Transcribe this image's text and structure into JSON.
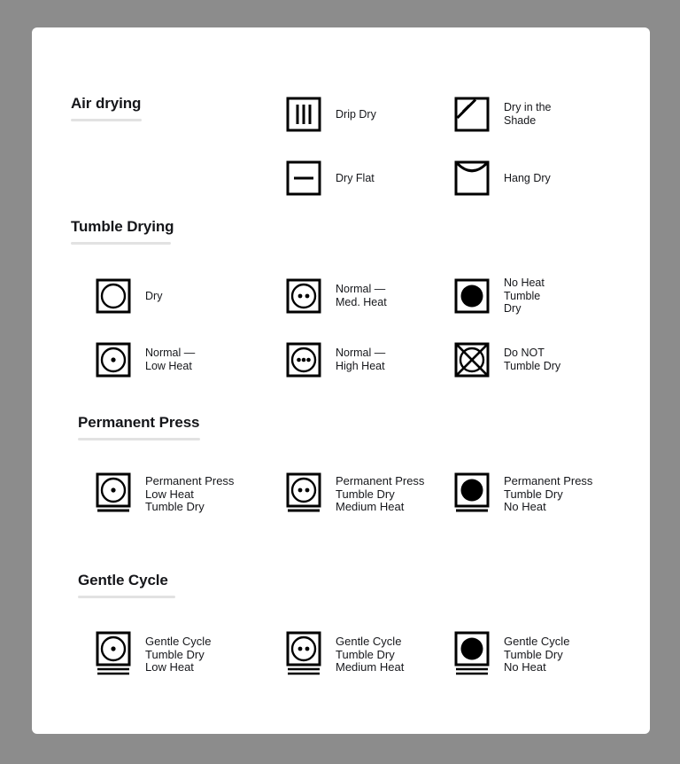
{
  "page": {
    "background_color": "#8c8c8c",
    "card_color": "#ffffff",
    "ink_color": "#000000",
    "rule_color": "#e2e2e2"
  },
  "sections": [
    {
      "id": "air-drying",
      "heading": "Air drying",
      "items": [
        {
          "id": "drip-dry",
          "icon": "square-three-vertical-lines-icon",
          "label": "Drip Dry"
        },
        {
          "id": "dry-in-shade",
          "icon": "square-diagonal-lines-corner-icon",
          "label": "Dry in the\nShade"
        },
        {
          "id": "dry-flat",
          "icon": "square-horizontal-line-icon",
          "label": "Dry Flat"
        },
        {
          "id": "hang-dry",
          "icon": "square-arc-icon",
          "label": "Hang Dry"
        }
      ]
    },
    {
      "id": "tumble-drying",
      "heading": "Tumble Drying",
      "items": [
        {
          "id": "tumble-dry",
          "icon": "square-circle-icon",
          "label": "Dry"
        },
        {
          "id": "normal-med-heat",
          "icon": "square-circle-two-dots-icon",
          "label": "Normal —\nMed. Heat"
        },
        {
          "id": "no-heat-tumble-dry",
          "icon": "square-filled-circle-icon",
          "label": "No Heat\nTumble\nDry"
        },
        {
          "id": "normal-low-heat",
          "icon": "square-circle-one-dot-icon",
          "label": "Normal —\nLow Heat"
        },
        {
          "id": "normal-high-heat",
          "icon": "square-circle-three-dots-icon",
          "label": "Normal —\nHigh Heat"
        },
        {
          "id": "do-not-tumble-dry",
          "icon": "square-circle-cross-icon",
          "label": "Do NOT\nTumble Dry"
        }
      ]
    },
    {
      "id": "permanent-press",
      "heading": "Permanent Press",
      "items": [
        {
          "id": "pp-low-heat",
          "icon": "square-circle-one-dot-one-bar-icon",
          "label": "Permanent Press\nLow Heat\nTumble Dry"
        },
        {
          "id": "pp-medium-heat",
          "icon": "square-circle-two-dots-one-bar-icon",
          "label": "Permanent Press\nTumble Dry\nMedium Heat"
        },
        {
          "id": "pp-no-heat",
          "icon": "square-filled-circle-one-bar-icon",
          "label": "Permanent Press\nTumble Dry\nNo Heat"
        }
      ]
    },
    {
      "id": "gentle-cycle",
      "heading": "Gentle Cycle",
      "items": [
        {
          "id": "gc-low-heat",
          "icon": "square-circle-one-dot-two-bars-icon",
          "label": "Gentle Cycle\nTumble Dry\nLow Heat"
        },
        {
          "id": "gc-medium-heat",
          "icon": "square-circle-two-dots-two-bars-icon",
          "label": "Gentle Cycle\nTumble Dry\nMedium Heat"
        },
        {
          "id": "gc-no-heat",
          "icon": "square-filled-circle-two-bars-icon",
          "label": "Gentle Cycle\nTumble Dry\nNo Heat"
        }
      ]
    }
  ]
}
